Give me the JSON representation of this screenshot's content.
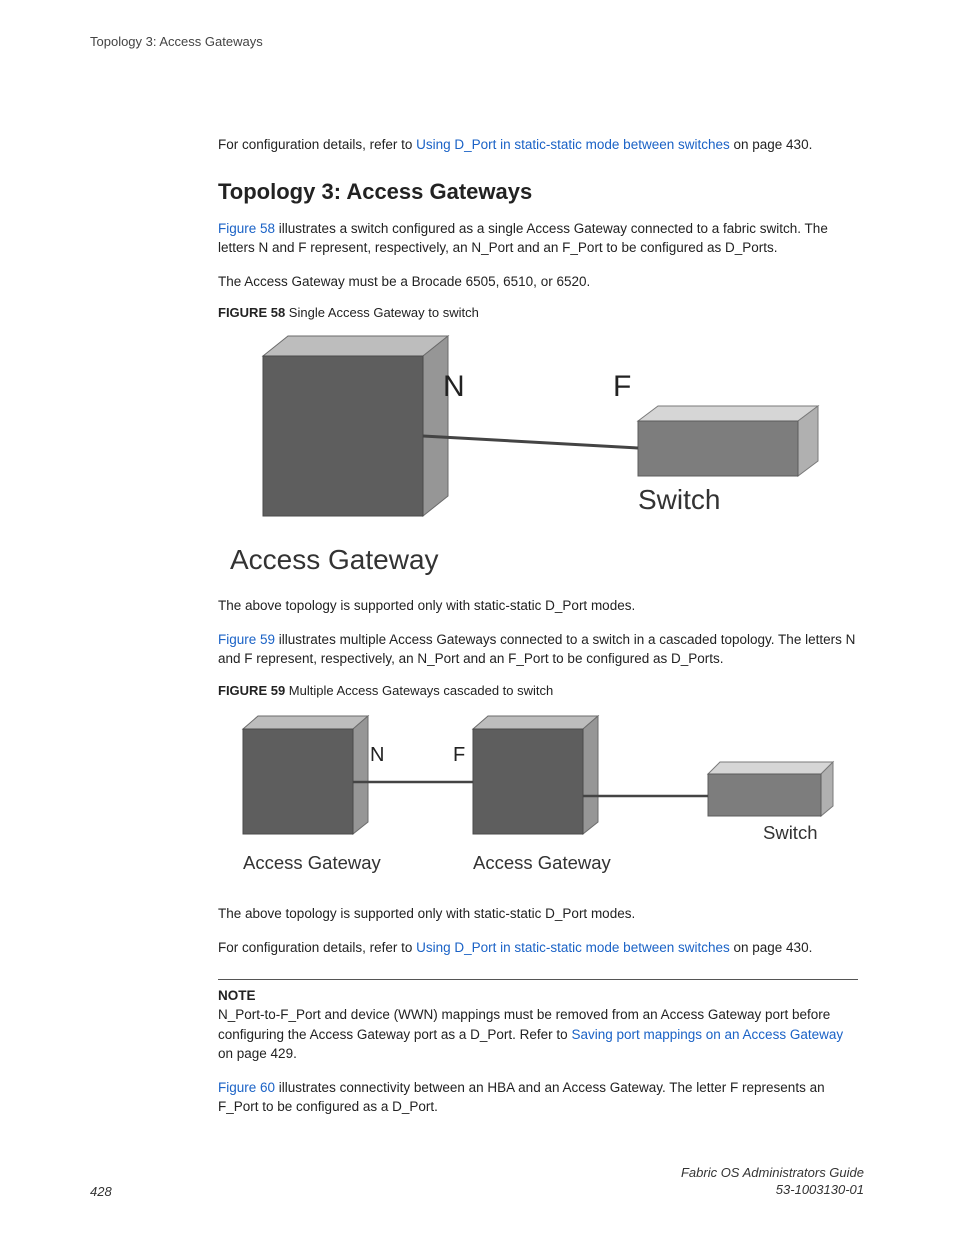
{
  "running_head": "Topology 3: Access Gateways",
  "intro": {
    "prefix": "For configuration details, refer to ",
    "link": "Using D_Port in static-static mode between switches",
    "suffix": " on page 430."
  },
  "heading": "Topology 3: Access Gateways",
  "p1": {
    "link": "Figure 58",
    "rest": " illustrates a switch configured as a single Access Gateway connected to a fabric switch. The letters N and F represent, respectively, an N_Port and an F_Port to be configured as D_Ports."
  },
  "p2": "The Access Gateway must be a Brocade 6505, 6510, or 6520.",
  "fig58": {
    "label": "FIGURE 58",
    "caption": " Single Access Gateway to switch",
    "N": "N",
    "F": "F",
    "switch": "Switch",
    "ag": "Access Gateway"
  },
  "p3": "The above topology is supported only with static-static D_Port modes.",
  "p4": {
    "link": "Figure 59",
    "rest": " illustrates multiple Access Gateways connected to a switch in a cascaded topology. The letters N and F represent, respectively, an N_Port and an F_Port to be configured as D_Ports."
  },
  "fig59": {
    "label": "FIGURE 59",
    "caption": " Multiple Access Gateways cascaded to switch",
    "N": "N",
    "F": "F",
    "switch": "Switch",
    "ag1": "Access Gateway",
    "ag2": "Access Gateway"
  },
  "p5": "The above topology is supported only with static-static D_Port modes.",
  "p6": {
    "prefix": "For configuration details, refer to ",
    "link": "Using D_Port in static-static mode between switches",
    "suffix": " on page 430."
  },
  "note": {
    "label": "NOTE",
    "text1": "N_Port-to-F_Port and device (WWN) mappings must be removed from an Access Gateway port before configuring the Access Gateway port as a D_Port. Refer to ",
    "link": "Saving port mappings on an Access Gateway",
    "text2": " on page 429."
  },
  "p7": {
    "link": "Figure 60",
    "rest": " illustrates connectivity between an HBA and an Access Gateway. The letter F represents an F_Port to be configured as a D_Port."
  },
  "footer": {
    "page": "428",
    "title": "Fabric OS Administrators Guide",
    "doc": "53-1003130-01"
  }
}
